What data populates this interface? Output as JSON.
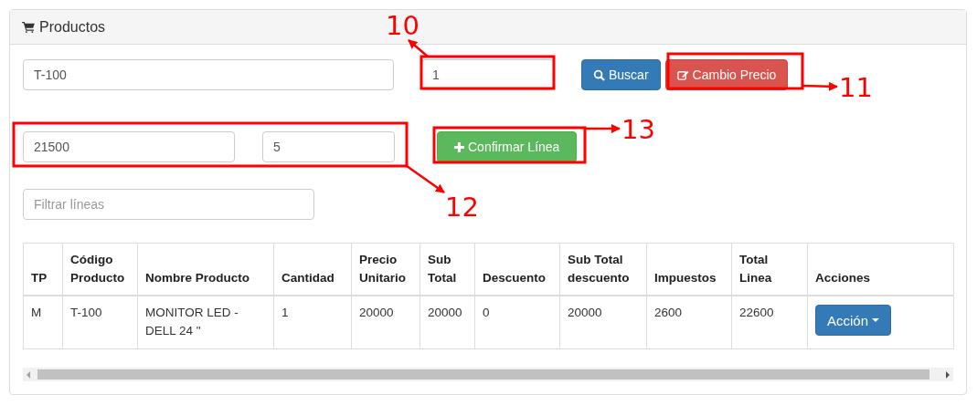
{
  "panel": {
    "title": "Productos"
  },
  "product_code": {
    "value": "T-100"
  },
  "quantity": {
    "value": "1"
  },
  "buttons": [
    {
      "label": "Buscar",
      "kind": "search"
    },
    {
      "label": "Cambio Precio",
      "kind": "edit"
    }
  ],
  "price": {
    "value": "21500"
  },
  "line_quantity": {
    "value": "5"
  },
  "confirm_button": {
    "label": "Confirmar Línea"
  },
  "filter": {
    "placeholder": "Filtrar líneas"
  },
  "table": {
    "columns": [
      "TP",
      "Código Producto",
      "Nombre Producto",
      "Cantidad",
      "Precio Unitario",
      "Sub Total",
      "Descuento",
      "Sub Total descuento",
      "Impuestos",
      "Total Linea",
      "Acciones"
    ],
    "rows": [
      {
        "cells": [
          "M",
          "T-100",
          "MONITOR LED - DELL 24 \"",
          "1",
          "20000",
          "20000",
          "0",
          "20000",
          "2600",
          "22600"
        ],
        "action": "Acción"
      }
    ]
  },
  "annotations": [
    {
      "label": "10"
    },
    {
      "label": "11"
    },
    {
      "label": "12"
    },
    {
      "label": "13"
    }
  ]
}
